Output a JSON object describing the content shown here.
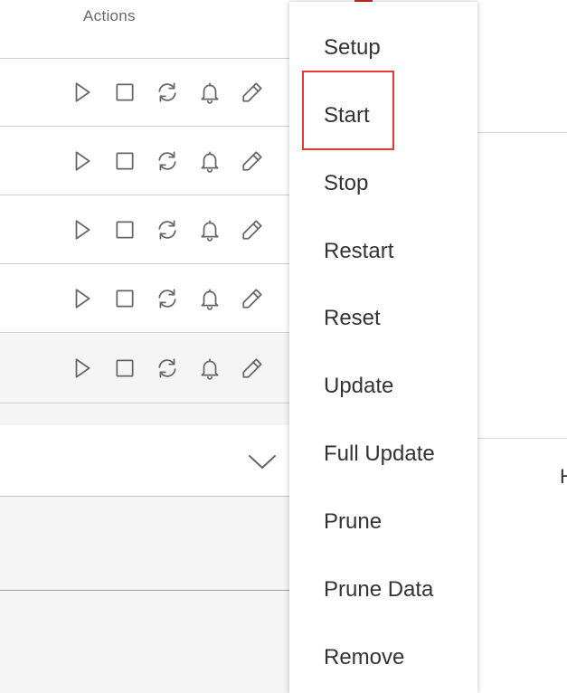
{
  "table": {
    "actions_header": "Actions"
  },
  "row_icons": [
    "play-icon",
    "stop-icon",
    "restart-icon",
    "bell-icon",
    "edit-icon"
  ],
  "menu": {
    "items": [
      {
        "label": "Setup"
      },
      {
        "label": "Start",
        "highlighted": true
      },
      {
        "label": "Stop"
      },
      {
        "label": "Restart"
      },
      {
        "label": "Reset"
      },
      {
        "label": "Update"
      },
      {
        "label": "Full Update"
      },
      {
        "label": "Prune"
      },
      {
        "label": "Prune Data"
      },
      {
        "label": "Remove"
      }
    ]
  },
  "right_panel": {
    "partial_text": "H"
  },
  "colors": {
    "highlight_border": "#e53935",
    "row_shaded": "#f5f5f5",
    "icon_stroke": "#666666"
  }
}
